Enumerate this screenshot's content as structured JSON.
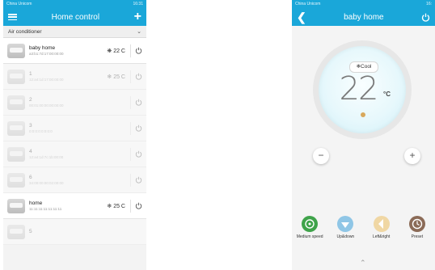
{
  "list_screen": {
    "status": {
      "carrier": "China Unicom",
      "time": "16:31"
    },
    "title": "Home control",
    "filter": "Air conditioner",
    "devices": [
      {
        "name": "baby home",
        "mac": "a3:b1:7d:17:00:00:00",
        "state": "22 C",
        "mode_icon": "fan-icon",
        "online": true
      },
      {
        "name": "1",
        "mac": "12:a4:1d:17:00:00:00",
        "state": "25 C",
        "mode_icon": "snowflake-icon",
        "online": false
      },
      {
        "name": "2",
        "mac": "00:01:00:00:00:00:00",
        "state": "",
        "mode_icon": "",
        "online": false
      },
      {
        "name": "3",
        "mac": "0:0:0:0:0:0:0:0",
        "state": "",
        "mode_icon": "",
        "online": false
      },
      {
        "name": "4",
        "mac": "12:a4:1d:7c:1b:00:00",
        "state": "",
        "mode_icon": "",
        "online": false
      },
      {
        "name": "6",
        "mac": "34:00:00:00:02:00:00",
        "state": "",
        "mode_icon": "",
        "online": false
      },
      {
        "name": "home",
        "mac": "11:11:11:11:11:11:11",
        "state": "25 C",
        "mode_icon": "snowflake-icon",
        "online": true
      },
      {
        "name": "5",
        "mac": "",
        "state": "",
        "mode_icon": "",
        "online": false
      }
    ]
  },
  "detail_screen": {
    "status": {
      "carrier": "China Unicom",
      "time": "16:"
    },
    "title": "baby home",
    "mode": "Cool",
    "temperature": "22",
    "unit": "°C",
    "minus": "−",
    "plus": "+",
    "functions": [
      {
        "label": "Medium speed",
        "color": "#3fa34a"
      },
      {
        "label": "Up&down",
        "color": "#8fc6e6"
      },
      {
        "label": "Left&right",
        "color": "#f0d7a4"
      },
      {
        "label": "Preset",
        "color": "#8b6b57"
      }
    ]
  },
  "colors": {
    "accent": "#1aa7d9"
  }
}
